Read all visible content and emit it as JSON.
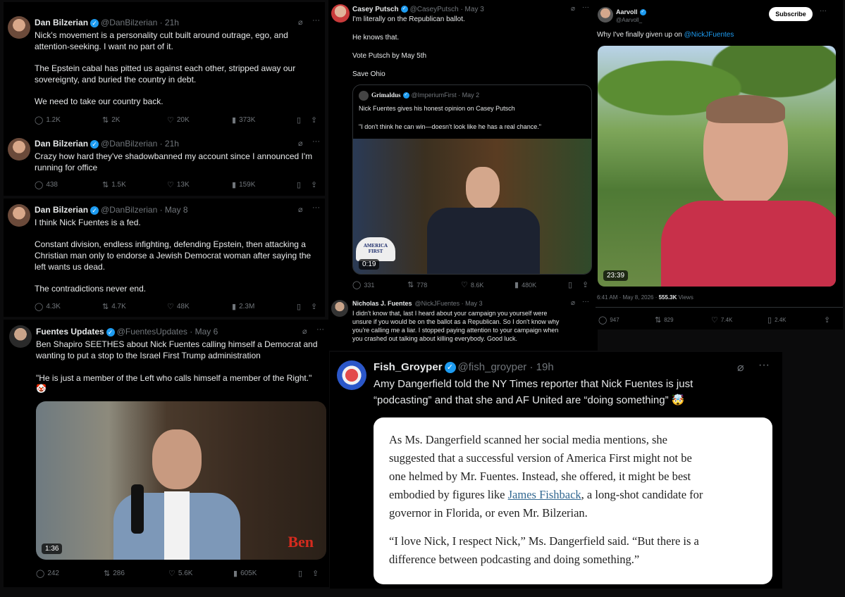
{
  "tweets": {
    "bilz1": {
      "name": "Dan Bilzerian",
      "handle": "@DanBilzerian · 21h",
      "lines": [
        "Nick's movement is a personality cult built around outrage, ego, and",
        "attention-seeking. I want no part of it.",
        "The Epstein cabal has pitted us against each other, stripped away our",
        "sovereignty, and buried the country in debt.",
        "We need to take our country back."
      ],
      "replies": "1.2K",
      "reposts": "2K",
      "likes": "20K",
      "views": "373K"
    },
    "bilz2": {
      "name": "Dan Bilzerian",
      "handle": "@DanBilzerian · 21h",
      "lines": [
        "Crazy how hard they've shadowbanned my account since I announced I'm",
        "running for office"
      ],
      "replies": "438",
      "reposts": "1.5K",
      "likes": "13K",
      "views": "159K"
    },
    "bilz3": {
      "name": "Dan Bilzerian",
      "handle": "@DanBilzerian · May 8",
      "lines": [
        "I think Nick Fuentes is a fed.",
        "Constant division, endless infighting, defending Epstein, then attacking a",
        "Christian man only to endorse a Jewish Democrat woman after saying the",
        "left wants us dead.",
        "The contradictions never end."
      ],
      "replies": "4.3K",
      "reposts": "4.7K",
      "likes": "48K",
      "views": "2.3M"
    },
    "fuentesupd": {
      "name": "Fuentes Updates",
      "handle": "@FuentesUpdates · May 6",
      "lines": [
        "Ben Shapiro SEETHES about Nick Fuentes calling himself a Democrat and",
        "wanting to put a stop to the Israel First Trump administration",
        "\"He is just a member of the Left who calls himself a member of the Right.\"",
        "🤡"
      ],
      "duration": "1:36",
      "watermark": "Ben",
      "replies": "242",
      "reposts": "286",
      "likes": "5.6K",
      "views": "605K"
    },
    "putsch": {
      "name": "Casey Putsch",
      "handle": "@CaseyPutsch · May 3",
      "lines": [
        "I'm literally on the Republican ballot.",
        "He knows that.",
        "Vote Putsch by May 5th",
        "Save Ohio"
      ],
      "quote": {
        "name": "Grimaldus",
        "handle": "@ImperiumFirst · May 2",
        "lines": [
          "Nick Fuentes gives his honest opinion on Casey Putsch",
          "\"I don't think he can win—doesn't look like he has a real chance.\""
        ],
        "duration": "0:19",
        "hat_text": "AMERICA FIRST"
      },
      "replies": "331",
      "reposts": "778",
      "likes": "8.6K",
      "views": "480K"
    },
    "njf": {
      "name": "Nicholas J. Fuentes",
      "handle": "@NickJFuentes · May 3",
      "lines": [
        "I didn't know that, last I heard about your campaign you yourself were",
        "unsure if you would be on the ballot as a Republican. So I don't know why",
        "you're calling me a liar. I stopped paying attention to your campaign when",
        "you crashed out talking about killing everybody. Good luck."
      ]
    },
    "aarvoll": {
      "name": "Aarvoll",
      "handle": "@Aarvoll_",
      "subscribe": "Subscribe",
      "text_prefix": "Why I've finally given up on ",
      "text_link": "@NickJFuentes",
      "duration": "23:39",
      "meta_time": "6:41 AM · May 8, 2026 · ",
      "meta_views": "555.3K",
      "meta_views_label": " Views",
      "replies": "947",
      "reposts": "829",
      "likes": "7.4K",
      "bookmarks": "2.4K"
    },
    "groyper": {
      "name": "Fish_Groyper",
      "handle": "@fish_groyper · 19h",
      "lines": [
        "Amy Dangerfield told the NY Times reporter that Nick Fuentes is just",
        "“podcasting” and that she and AF United are “doing something” 🤯"
      ],
      "article": {
        "p1": [
          "As Ms. Dangerfield scanned her social media mentions, she",
          "suggested that a successful version of America First might not be",
          "one helmed by Mr. Fuentes. Instead, she offered, it might be best"
        ],
        "p1_prefix": "embodied by figures like ",
        "p1_link": "James Fishback",
        "p1_suffix": ", a long-shot candidate for",
        "p1_last": "governor in Florida, or even Mr. Bilzerian.",
        "p2": [
          "“I love Nick, I respect Nick,” Ms. Dangerfield said. “But there is a",
          "difference between podcasting and doing something.”"
        ]
      }
    }
  },
  "icons": {
    "reply": "speech-bubble",
    "repost": "two-arrows",
    "like": "heart",
    "views": "bar-chart",
    "bookmark": "bookmark",
    "share": "upload",
    "grok": "grok-slash",
    "more": "ellipsis"
  },
  "colors": {
    "accent": "#1d9bf0",
    "muted": "#71767b",
    "text": "#e7e9ea"
  }
}
